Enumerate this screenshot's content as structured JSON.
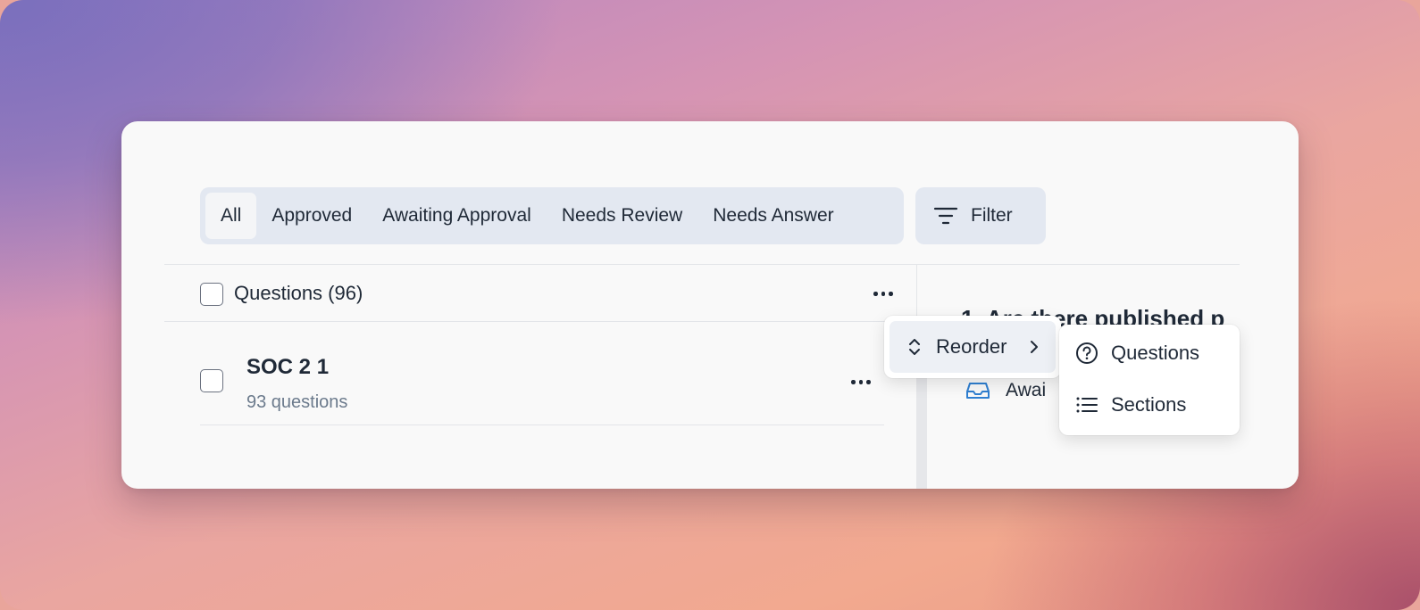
{
  "tabs": {
    "items": [
      {
        "label": "All"
      },
      {
        "label": "Approved"
      },
      {
        "label": "Awaiting Approval"
      },
      {
        "label": "Needs Review"
      },
      {
        "label": "Needs Answer"
      }
    ],
    "active": "All"
  },
  "filter": {
    "label": "Filter",
    "icon": "filter-icon"
  },
  "questions_header": {
    "label": "Questions (96)"
  },
  "section": {
    "title": "SOC 2 1",
    "subtitle": "93 questions"
  },
  "detail": {
    "title": "1. Are there published p",
    "status": "Awai"
  },
  "context_menu": {
    "reorder_label": "Reorder",
    "submenu": [
      {
        "label": "Questions",
        "icon": "question-circle-icon"
      },
      {
        "label": "Sections",
        "icon": "list-icon"
      }
    ]
  },
  "colors": {
    "accent_blue": "#2f7fd1",
    "tab_bg": "#e3e8f1"
  }
}
